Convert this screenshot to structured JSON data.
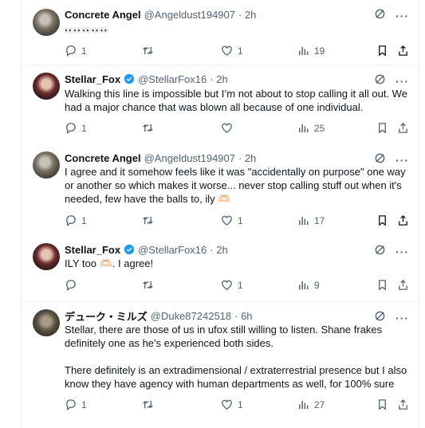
{
  "tweets": [
    {
      "name": "Concrete Angel",
      "handle": "@Angeldust194907",
      "time": "· 2h",
      "verified": false,
      "avatar": "concrete-angel-avatar",
      "lines": [
        "👀👀👀👀👀"
      ],
      "replies": "1",
      "retweets": "",
      "likes": "1",
      "views": "19"
    },
    {
      "name": "Stellar_Fox",
      "handle": "@StellarFox16",
      "time": "· 2h",
      "verified": true,
      "avatar": "stellar-fox-avatar",
      "lines": [
        "Walking this line is impossible but I’m not about to stop calling it all out. We",
        "had a major chance that was blown all because of one individual."
      ],
      "replies": "1",
      "retweets": "",
      "likes": "",
      "views": "25"
    },
    {
      "name": "Concrete Angel",
      "handle": "@Angeldust194907",
      "time": "· 2h",
      "verified": false,
      "avatar": "concrete-angel-avatar",
      "lines": [
        "I agree and it somehow feels like it was \"accidentally on purpose\" one way",
        "or another so which makes it worse... never stop calling stuff out when it's",
        "needed, few have the balls to, ily 🫶🏻"
      ],
      "replies": "1",
      "retweets": "",
      "likes": "1",
      "views": "17"
    },
    {
      "name": "Stellar_Fox",
      "handle": "@StellarFox16",
      "time": "· 2h",
      "verified": true,
      "avatar": "stellar-fox-avatar",
      "lines": [
        "ILY too 🫶🏻. I agree!"
      ],
      "replies": "",
      "retweets": "",
      "likes": "1",
      "views": "9"
    },
    {
      "name": "デューク・ミルズ",
      "handle": "@Duke87242518",
      "time": "· 6h",
      "verified": false,
      "avatar": "duke-avatar",
      "lines": [
        "Stellar, there are those of us in ufox still willing to listen. Shane frakes",
        "definitely one as he's experienced both sides.",
        "",
        "There definitely is an extradimensional / extraterrestrial presence but I also",
        "know they have agency with human departments as well, for 100% sure"
      ],
      "replies": "1",
      "retweets": "",
      "likes": "1",
      "views": "27"
    }
  ],
  "colors": {
    "text": "#0f1419",
    "secondary": "#536471",
    "verified": "#1d9bf0",
    "border": "#eff3f4"
  },
  "icons": [
    "grok-icon",
    "more-icon",
    "reply-icon",
    "retweet-icon",
    "like-icon",
    "views-icon",
    "bookmark-icon",
    "share-icon",
    "verified-badge-icon"
  ]
}
